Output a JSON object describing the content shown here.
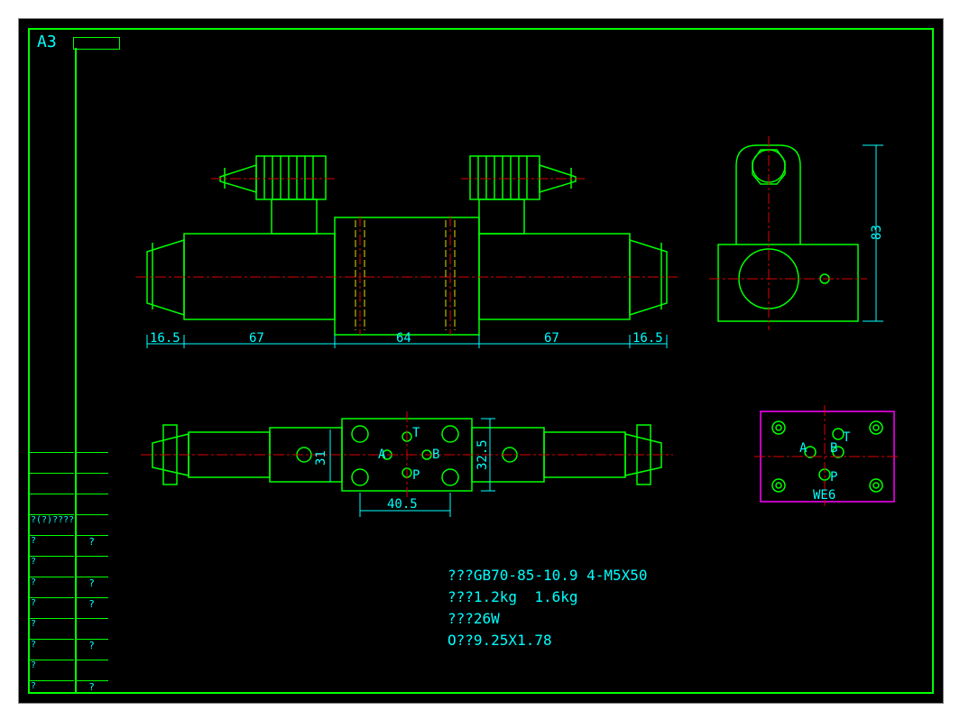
{
  "sheet": "A3",
  "dims": {
    "d165a": "16.5",
    "d67a": "67",
    "d64": "64",
    "d67b": "67",
    "d165b": "16.5",
    "d83": "83",
    "d31": "31",
    "d325": "32.5",
    "d405": "40.5"
  },
  "ports": {
    "A": "A",
    "B": "B",
    "T": "T",
    "P": "P",
    "WE6": "WE6"
  },
  "notes": {
    "l1": "???GB70-85-10.9 4-M5X50",
    "l2": "???1.2kg  1.6kg",
    "l3": "???26W",
    "l4": "O??9.25X1.78"
  },
  "rev": {
    "q": "?",
    "qm": "?(?)????"
  }
}
